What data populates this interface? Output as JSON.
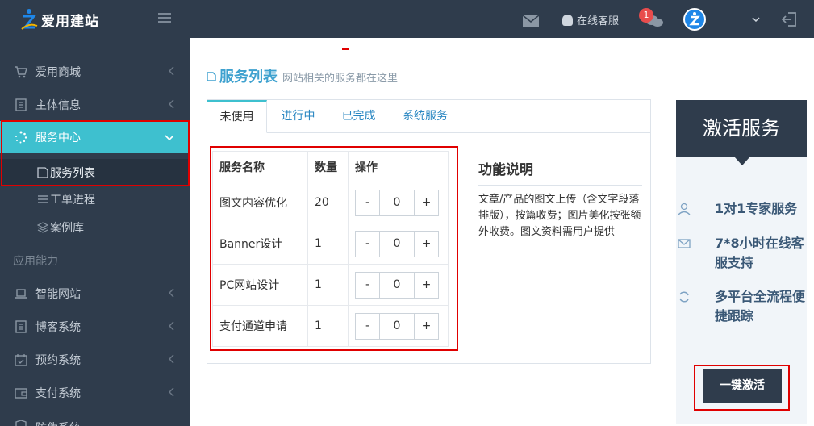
{
  "app": {
    "logo_text": "爱用建站"
  },
  "topbar": {
    "kefu_label": "在线客服",
    "notification_count": "1"
  },
  "sidebar": {
    "items": [
      {
        "label": "爱用商城",
        "icon": "cart-icon"
      },
      {
        "label": "主体信息",
        "icon": "document-icon"
      },
      {
        "label": "服务中心",
        "icon": "spinner-icon"
      }
    ],
    "subitems": [
      {
        "label": "服务列表",
        "icon": "edit-icon"
      },
      {
        "label": "工单进程",
        "icon": "list-icon"
      },
      {
        "label": "案例库",
        "icon": "layers-icon"
      }
    ],
    "group_label": "应用能力",
    "items2": [
      {
        "label": "智能网站",
        "icon": "laptop-icon"
      },
      {
        "label": "博客系统",
        "icon": "document-icon"
      },
      {
        "label": "预约系统",
        "icon": "calendar-icon"
      },
      {
        "label": "支付系统",
        "icon": "wallet-icon"
      },
      {
        "label": "防伪系统",
        "icon": "shield-icon"
      }
    ]
  },
  "page": {
    "title": "服务列表",
    "subtitle": "网站相关的服务都在这里"
  },
  "tabs": [
    "未使用",
    "进行中",
    "已完成",
    "系统服务"
  ],
  "table": {
    "headers": [
      "服务名称",
      "数量",
      "操作"
    ],
    "rows": [
      {
        "name": "图文内容优化",
        "qty": "20",
        "value": "0"
      },
      {
        "name": "Banner设计",
        "qty": "1",
        "value": "0"
      },
      {
        "name": "PC网站设计",
        "qty": "1",
        "value": "0"
      },
      {
        "name": "支付通道申请",
        "qty": "1",
        "value": "0"
      }
    ],
    "minus": "-",
    "plus": "+"
  },
  "description": {
    "title": "功能说明",
    "text": "文章/产品的图文上传（含文字段落排版），按篇收费；图片美化按张额外收费。图文资料需用户提供"
  },
  "card": {
    "title": "激活服务",
    "features": [
      {
        "text": "1对1专家服务",
        "icon": "user-icon"
      },
      {
        "text": "7*8小时在线客服支持",
        "icon": "mail-icon"
      },
      {
        "text": "多平台全流程便捷跟踪",
        "icon": "refresh-icon"
      }
    ],
    "button": "一键激活"
  },
  "colors": {
    "topbar": "#2f3c4c",
    "accent": "#3ec0cf",
    "title_blue": "#3ea1cf",
    "highlight_red": "#e00000"
  }
}
